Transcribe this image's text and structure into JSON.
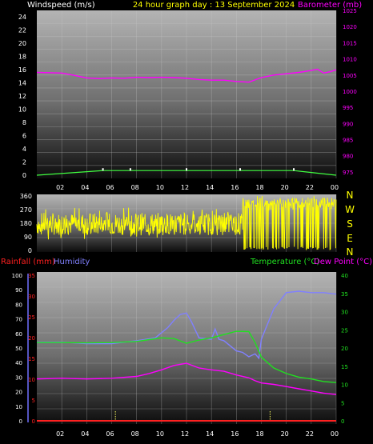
{
  "header": {
    "left": "Windspeed (m/s)",
    "center": "24 hour graph day : 13 September 2024",
    "right": "Barometer (mb)"
  },
  "colors": {
    "windspeed_label": "#ffffff",
    "title": "#ffff00",
    "barometer": "#ff00ff",
    "wind_direction": "#ffff00",
    "compass": "#ffff00",
    "rainfall": "#ff2020",
    "humidity": "#8080ff",
    "temperature": "#20e020",
    "dew_point": "#ff00ff",
    "windspeed": "#40ff40"
  },
  "compass": [
    "N",
    "W",
    "S",
    "E",
    "N"
  ],
  "bottom_header": {
    "rainfall": "Rainfall (mm)",
    "humidity": "Humidity",
    "temperature": "Temperature (°C)",
    "dew_point": "Dew Point (°C)"
  },
  "chart_data": [
    {
      "type": "line",
      "name": "windspeed-barometer",
      "x_ticks": [
        "02",
        "04",
        "06",
        "08",
        "10",
        "12",
        "14",
        "16",
        "18",
        "20",
        "22",
        "00"
      ],
      "left_axis": {
        "label": "Windspeed (m/s)",
        "ylim": [
          0,
          25
        ],
        "ticks": [
          0,
          2,
          4,
          6,
          8,
          10,
          12,
          14,
          16,
          18,
          20,
          22,
          24
        ]
      },
      "right_axis": {
        "label": "Barometer (mb)",
        "ylim": [
          973,
          1025
        ],
        "ticks": [
          975,
          980,
          985,
          990,
          995,
          1000,
          1005,
          1010,
          1015,
          1020,
          1025
        ]
      },
      "series": [
        {
          "name": "Barometer (mb)",
          "axis": "right",
          "x": [
            0,
            2,
            3,
            4,
            5,
            6,
            7,
            8,
            9,
            10,
            11,
            12,
            13,
            14,
            15,
            16,
            17,
            18,
            19,
            20,
            21,
            22,
            22.5,
            23,
            23.5,
            24
          ],
          "y": [
            1005.8,
            1005.6,
            1004.9,
            1004.1,
            1003.9,
            1004.1,
            1004.0,
            1004.3,
            1004.2,
            1004.3,
            1004.2,
            1004.0,
            1003.6,
            1003.4,
            1003.4,
            1003.0,
            1002.8,
            1004.2,
            1005.0,
            1005.4,
            1005.8,
            1006.4,
            1006.8,
            1005.6,
            1006.0,
            1006.6
          ]
        },
        {
          "name": "Windspeed (m/s)",
          "axis": "left",
          "x": [
            0,
            5.3,
            7.5,
            12.0,
            16.3,
            20.6,
            24
          ],
          "y": [
            0,
            0.7,
            0.7,
            0.7,
            0.7,
            0.7,
            0
          ]
        }
      ]
    },
    {
      "type": "line",
      "name": "wind-direction",
      "x_ticks": [
        "02",
        "04",
        "06",
        "08",
        "10",
        "12",
        "14",
        "16",
        "18",
        "20",
        "22",
        "00"
      ],
      "left_axis": {
        "ylim": [
          0,
          360
        ],
        "ticks": [
          0,
          90,
          180,
          270,
          360
        ]
      },
      "right_axis": {
        "labels": [
          "N",
          "W",
          "S",
          "E",
          "N"
        ]
      },
      "series": [
        {
          "name": "Wind direction",
          "noisy": true,
          "segments": [
            {
              "x_from": 0,
              "x_to": 16.5,
              "center": 175,
              "spread": 75
            },
            {
              "x_from": 16.5,
              "x_to": 24,
              "center": 315,
              "spread": 35,
              "dropouts": true
            }
          ]
        }
      ]
    },
    {
      "type": "line",
      "name": "rain-humidity-temperature-dewpoint",
      "x_ticks": [
        "02",
        "04",
        "06",
        "08",
        "10",
        "12",
        "14",
        "16",
        "18",
        "20",
        "22",
        "00"
      ],
      "humidity_axis": {
        "ylim": [
          0,
          100
        ],
        "ticks": [
          0,
          10,
          20,
          30,
          40,
          50,
          60,
          70,
          80,
          90,
          100
        ]
      },
      "rain_axis": {
        "ylim": [
          0,
          35
        ],
        "ticks": [
          0,
          5,
          10,
          15,
          20,
          25,
          30,
          35
        ]
      },
      "temperature_axis": {
        "ylim": [
          0,
          40
        ],
        "ticks": [
          0,
          5,
          10,
          15,
          20,
          25,
          30,
          35,
          40
        ]
      },
      "markers_hours": [
        6.3,
        18.7
      ],
      "series": [
        {
          "name": "Humidity",
          "axis": "humidity",
          "x": [
            0,
            2,
            4,
            6,
            8,
            9.5,
            10.5,
            11,
            11.5,
            12,
            12.4,
            13,
            14,
            14.3,
            14.6,
            15,
            16,
            16.5,
            17,
            17.5,
            17.8,
            18,
            19,
            20,
            21,
            22,
            23,
            24
          ],
          "y": [
            54,
            54,
            53,
            53,
            55,
            57,
            64,
            69,
            73,
            74,
            68,
            57,
            56,
            63,
            56,
            55,
            48,
            47,
            44,
            46,
            43,
            56,
            77,
            88,
            89,
            88,
            88,
            87
          ]
        },
        {
          "name": "Temperature (°C)",
          "axis": "temperature",
          "x": [
            0,
            2,
            4,
            6,
            8,
            9,
            10,
            11,
            12,
            13,
            14,
            15,
            16,
            17,
            17.5,
            18,
            19,
            20,
            21,
            22,
            23,
            24
          ],
          "y": [
            21.5,
            21.5,
            21.4,
            21.5,
            21.8,
            22.3,
            22.8,
            22.6,
            21.3,
            22.2,
            22.8,
            23.7,
            24.6,
            24.5,
            21.5,
            17.5,
            14.5,
            13,
            12,
            11.5,
            10.8,
            10.5
          ]
        },
        {
          "name": "Dew Point (°C)",
          "axis": "temperature",
          "x": [
            0,
            2,
            4,
            6,
            8,
            9,
            10,
            11,
            12,
            13,
            14,
            15,
            16,
            17,
            17.5,
            18,
            19,
            20,
            21,
            22,
            23,
            24
          ],
          "y": [
            11.5,
            11.7,
            11.5,
            11.7,
            12.2,
            13.0,
            14.0,
            15.2,
            15.8,
            14.5,
            14.0,
            13.6,
            12.6,
            11.8,
            11.0,
            10.4,
            10.0,
            9.4,
            8.8,
            8.2,
            7.6,
            7.2
          ]
        },
        {
          "name": "Rainfall (mm)",
          "axis": "rain",
          "x": [
            0,
            24
          ],
          "y": [
            0,
            0
          ]
        }
      ]
    }
  ]
}
